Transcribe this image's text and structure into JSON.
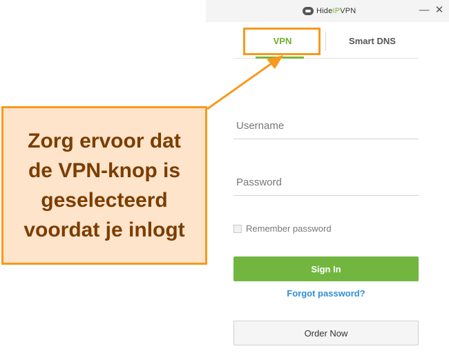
{
  "window": {
    "logo_prefix": "Hide",
    "logo_highlight": "IP",
    "logo_suffix": "VPN",
    "minimize_glyph": "—",
    "close_glyph": "✕"
  },
  "tabs": [
    {
      "label": "VPN",
      "active": true
    },
    {
      "label": "Smart DNS",
      "active": false
    }
  ],
  "form": {
    "username_placeholder": "Username",
    "password_placeholder": "Password",
    "remember_label": "Remember password",
    "remember_checked": false,
    "signin_label": "Sign In",
    "forgot_label": "Forgot password?",
    "order_label": "Order Now"
  },
  "annotation": {
    "text": "Zorg ervoor dat\nde VPN-knop is\ngeselecteerd\nvoordat je inlogt"
  },
  "colors": {
    "accent_green": "#72b640",
    "link_blue": "#2f8fd8",
    "callout_border": "#f7991c",
    "callout_bg": "#fde4ca",
    "callout_text": "#7b3d00"
  }
}
